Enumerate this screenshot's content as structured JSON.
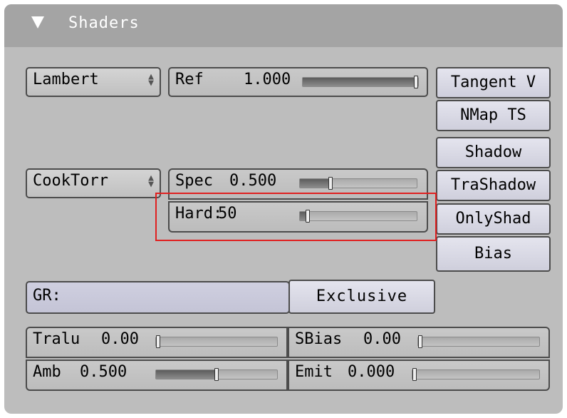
{
  "panel": {
    "title": "Shaders",
    "icons": {
      "collapse": "triangle-down-icon",
      "menu_arrows": "up-down-arrows-icon"
    }
  },
  "diffuse": {
    "shader_menu": "Lambert",
    "ref": {
      "label": "Ref",
      "value": "1.000",
      "fraction": 1.0
    }
  },
  "specular": {
    "shader_menu": "CookTorr",
    "spec": {
      "label": "Spec",
      "value": "0.500",
      "fraction": 0.25
    },
    "hard": {
      "label": "Hard:",
      "value": "50",
      "fraction": 0.05
    }
  },
  "toggles": [
    "Tangent V",
    "NMap TS",
    "Shadow",
    "TraShadow",
    "OnlyShad",
    "Bias"
  ],
  "group": {
    "label": "GR:",
    "value": "",
    "exclusive": "Exclusive"
  },
  "tralu": {
    "label": "Tralu",
    "value": "0.00",
    "fraction": 0.0
  },
  "sbias": {
    "label": "SBias",
    "value": "0.00",
    "fraction": 0.0
  },
  "amb": {
    "label": "Amb",
    "value": "0.500",
    "fraction": 0.5
  },
  "emit": {
    "label": "Emit",
    "value": "0.000",
    "fraction": 0.0
  },
  "colors": {
    "panel": "#bdbdbd",
    "header": "#a4a4a4",
    "highlight": "#e02020",
    "toggle": "#d8d8e4"
  }
}
